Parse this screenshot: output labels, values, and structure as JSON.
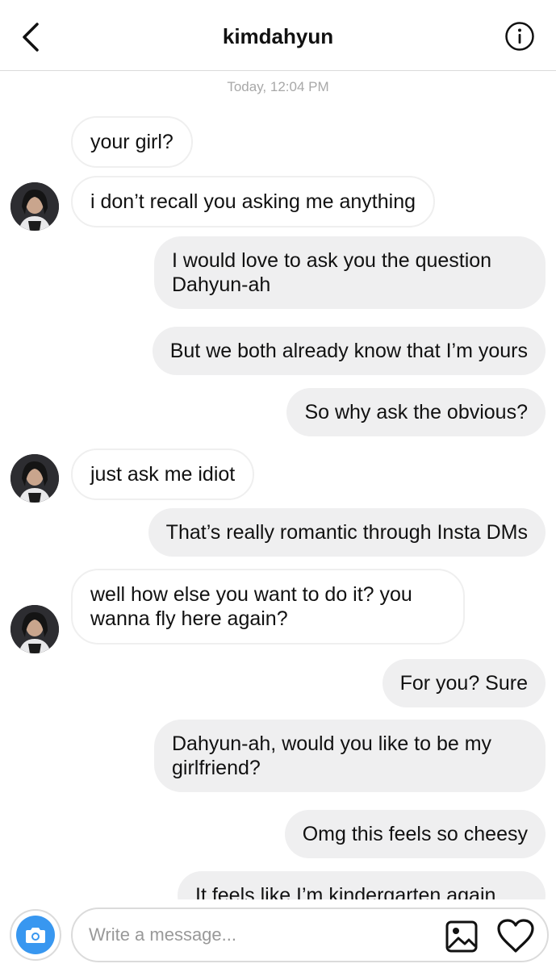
{
  "header": {
    "title": "kimdahyun",
    "back_icon": "chevron-left-icon",
    "info_icon": "info-circle-icon"
  },
  "thread": {
    "timestamp": "Today, 12:04 PM",
    "messages": [
      {
        "side": "in",
        "text": "your girl?",
        "avatar": false
      },
      {
        "side": "in",
        "text": "i don’t recall you asking me anything",
        "avatar": true
      },
      {
        "side": "out",
        "text": "I would love to ask you the question\nDahyun-ah"
      },
      {
        "side": "out",
        "text": "But we both already know that I’m yours"
      },
      {
        "side": "out",
        "text": "So why ask the obvious?"
      },
      {
        "side": "in",
        "text": "just ask me idiot",
        "avatar": true
      },
      {
        "side": "out",
        "text": "That’s really romantic through Insta DMs"
      },
      {
        "side": "in",
        "text": "well how else you want to do it? you\nwanna fly here again?",
        "avatar": true
      },
      {
        "side": "out",
        "text": "For you? Sure"
      },
      {
        "side": "out",
        "text": "Dahyun-ah, would you like to be my\ngirlfriend?"
      },
      {
        "side": "out",
        "text": "Omg this feels so cheesy"
      },
      {
        "side": "out",
        "text": "It feels like I’m kindergarten again"
      }
    ]
  },
  "composer": {
    "placeholder": "Write a message...",
    "camera_icon": "camera-icon",
    "gallery_icon": "image-gallery-icon",
    "heart_icon": "heart-icon",
    "accent": "#3897f0"
  },
  "colors": {
    "outgoing_bubble": "#efeff0",
    "incoming_border": "#efefef",
    "timestamp": "#a8a8a8"
  }
}
